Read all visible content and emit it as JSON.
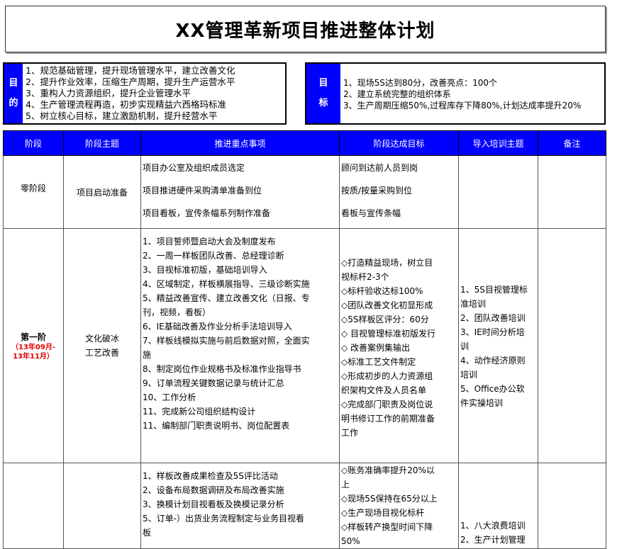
{
  "title": "XX管理革新项目推进整体计划",
  "purpose": {
    "label_top": "目",
    "label_bottom": "的",
    "lines": [
      "1、规范基础管理，提升现场管理水平，建立改善文化",
      "2、提升作业效率，压缩生产周期，提升生产运营水平",
      "3、重构人力资源组织，提升企业管理水平",
      "4、生产管理流程再造，初步实现精益六西格玛标准",
      "5、树立核心目标，建立激励机制，提升经营水平"
    ]
  },
  "target": {
    "label_top": "目",
    "label_bottom": "标",
    "lines": [
      "1、现场5S达到80分，改善亮点：100个",
      "2、建立系统完整的组织体系",
      "3、生产周期压缩50%,过程库存下降80%,计划达成率提升20%"
    ]
  },
  "table": {
    "headers": [
      "阶段",
      "阶段主题",
      "推进重点事项",
      "阶段达成目标",
      "导入培训主题",
      "备注"
    ],
    "row0": {
      "stage": "零阶段",
      "theme": "项目启动准备",
      "items": [
        "项目办公室及组织成员选定",
        "项目推进硬件采购清单准备到位",
        "项目看板，宣传条幅系列制作准备"
      ],
      "goals": [
        "顾问到达前人员到岗",
        "按质/按量采购到位",
        "看板与宣传条幅"
      ]
    },
    "row1": {
      "stage": "第一阶",
      "stage_sub1": "（13年09月-",
      "stage_sub2": "13年11月）",
      "theme1": "文化破冰",
      "theme2": "工艺改善",
      "items": [
        "1、项目誓师暨启动大会及制度发布",
        "2、一周一样板团队改善、总经理诊断",
        "3、目视标准初版，基础培训导入",
        "4、区域制定，样板横展指导、三级诊断实施",
        "5、精益改善宣传、建立改善文化（日报、专",
        "刊，视频，看板）",
        "6、IE基础改善及作业分析手法培训导入",
        "7、样板线模拟实施与前后数据对照，全面实",
        "施",
        "8、制定岗位作业规格书及标准作业指导书",
        "9、订单流程关键数据记录与统计汇总",
        "10、工作分析",
        "11、完成新公司组织结构设计",
        "11、编制部门职责说明书、岗位配置表"
      ],
      "goals": [
        "◇打造精益现场，树立目",
        "  视标杆2-3个",
        "◇标杆验收达标100%",
        "◇团队改善文化初显形成",
        "◇5S样板区评分：60分",
        "◇ 目视管理标准初版发行",
        "◇ 改善案例集输出",
        "◇标准工艺文件制定",
        "◇形成初步的人力资源组",
        "织架构文件及人员名单",
        "◇完成部门职责及岗位说",
        "明书修订工作的前期准备",
        "工作"
      ],
      "training": [
        "1、5S目视管理标",
        "准培训",
        "2、团队改善培训",
        "3、IE时间分析培",
        "训",
        "4、动作经济原则",
        "培训",
        "5、Office办公软",
        "件实操培训"
      ]
    },
    "row2": {
      "items": [
        "1、样板改善成果检查及5S评比活动",
        "2、设备布局数据调研及布局改善实施",
        "3、换模计划目视看板及换模记录分析",
        "5、订单-）出货业务流程制定与业务目视看",
        "板"
      ],
      "goals": [
        "◇账务准确率提升20%以",
        "上",
        "◇现场5S保持在65分以上",
        "◇生产现场目视化标杆",
        "◇样板转产换型时间下降",
        "50%"
      ],
      "training": [
        "1、八大浪费培训",
        "2、生产计划管理"
      ]
    }
  }
}
